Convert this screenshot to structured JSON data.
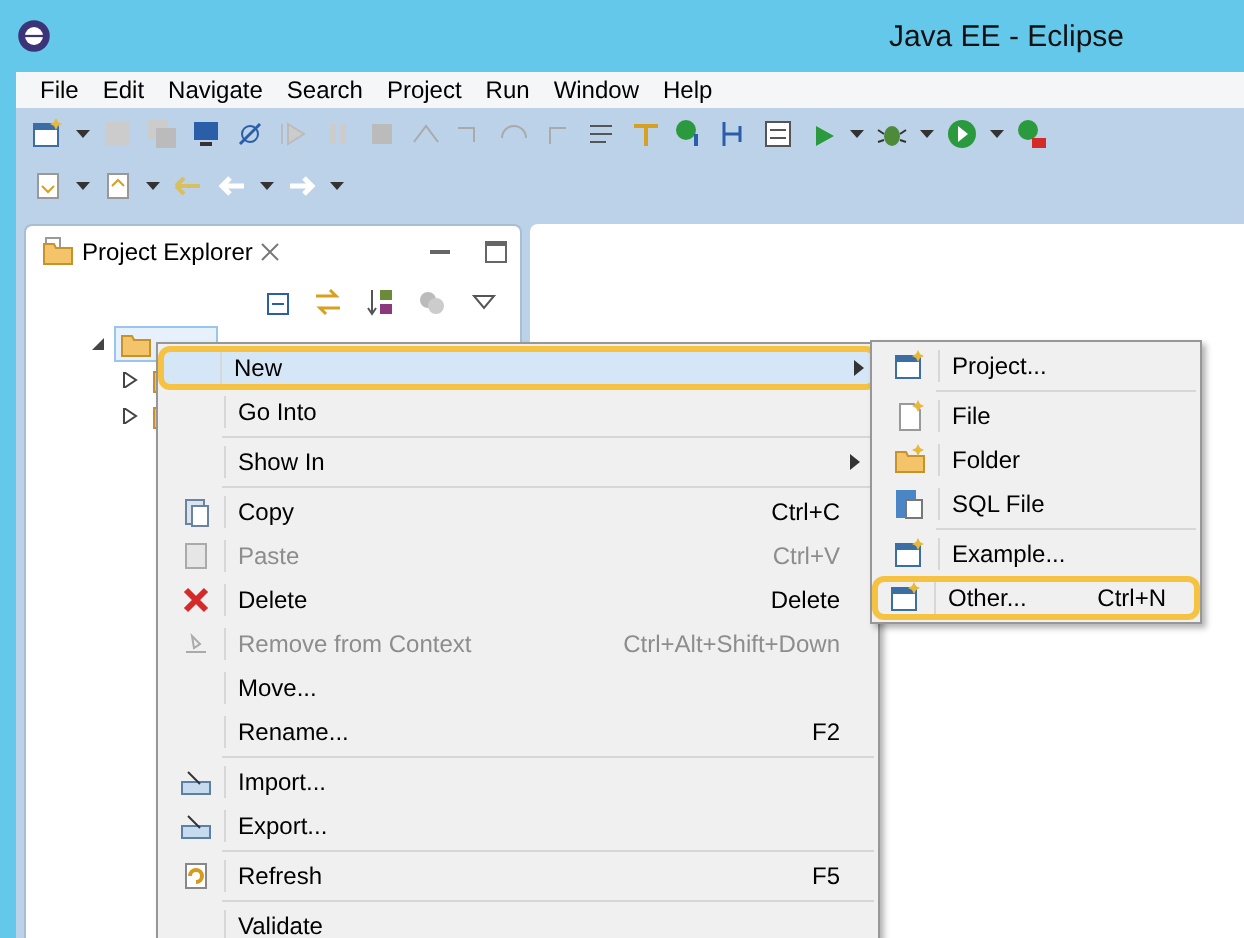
{
  "window": {
    "title": "Java EE - Eclipse"
  },
  "menu_bar": [
    "File",
    "Edit",
    "Navigate",
    "Search",
    "Project",
    "Run",
    "Window",
    "Help"
  ],
  "project_explorer": {
    "title": "Project Explorer",
    "tree": [
      {
        "expanded": true,
        "selected": true,
        "children": [
          {
            "expanded": false
          },
          {
            "expanded": false
          }
        ]
      }
    ]
  },
  "context_menu": {
    "groups": [
      [
        {
          "label": "New",
          "submenu": true,
          "selected": true,
          "annotated": true,
          "disabled": false
        },
        {
          "label": "Go Into",
          "submenu": false,
          "selected": false,
          "annotated": false,
          "disabled": false
        }
      ],
      [
        {
          "label": "Show In",
          "submenu": true,
          "selected": false,
          "annotated": false,
          "disabled": false
        }
      ],
      [
        {
          "label": "Copy",
          "shortcut": "Ctrl+C",
          "submenu": false,
          "selected": false,
          "annotated": false,
          "disabled": false
        },
        {
          "label": "Paste",
          "shortcut": "Ctrl+V",
          "submenu": false,
          "selected": false,
          "annotated": false,
          "disabled": true
        },
        {
          "label": "Delete",
          "shortcut": "Delete",
          "submenu": false,
          "selected": false,
          "annotated": false,
          "disabled": false
        },
        {
          "label": "Remove from Context",
          "shortcut": "Ctrl+Alt+Shift+Down",
          "submenu": false,
          "selected": false,
          "annotated": false,
          "disabled": true
        },
        {
          "label": "Move...",
          "submenu": false,
          "selected": false,
          "annotated": false,
          "disabled": false
        },
        {
          "label": "Rename...",
          "shortcut": "F2",
          "submenu": false,
          "selected": false,
          "annotated": false,
          "disabled": false
        }
      ],
      [
        {
          "label": "Import...",
          "submenu": false,
          "selected": false,
          "annotated": false,
          "disabled": false
        },
        {
          "label": "Export...",
          "submenu": false,
          "selected": false,
          "annotated": false,
          "disabled": false
        }
      ],
      [
        {
          "label": "Refresh",
          "shortcut": "F5",
          "submenu": false,
          "selected": false,
          "annotated": false,
          "disabled": false
        }
      ],
      [
        {
          "label": "Validate",
          "submenu": false,
          "selected": false,
          "annotated": false,
          "disabled": false
        }
      ]
    ]
  },
  "submenu": {
    "groups": [
      [
        {
          "label": "Project...",
          "annotated": false
        }
      ],
      [
        {
          "label": "File",
          "annotated": false
        },
        {
          "label": "Folder",
          "annotated": false
        },
        {
          "label": "SQL File",
          "annotated": false
        }
      ],
      [
        {
          "label": "Example...",
          "annotated": false
        },
        {
          "label": "Other...",
          "shortcut": "Ctrl+N",
          "annotated": true
        }
      ]
    ]
  }
}
